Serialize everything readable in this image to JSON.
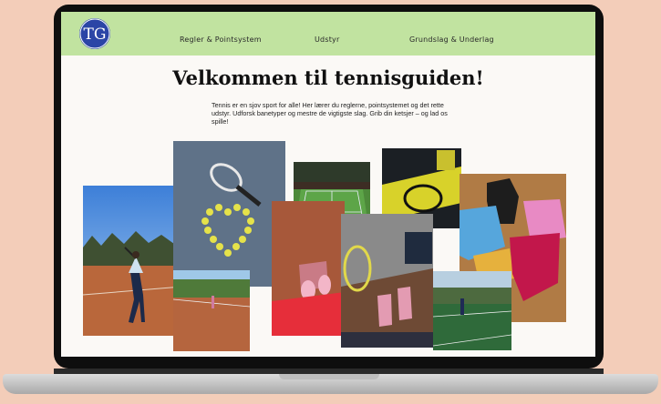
{
  "nav": {
    "logo_text": "TG",
    "links": [
      "Regler & Pointsystem",
      "Udstyr",
      "Grundslag & Underlag"
    ]
  },
  "hero": {
    "title": "Velkommen til tennisguiden!",
    "intro": "Tennis er en sjov sport for alle! Her lærer du reglerne, pointsystemet og det rette udstyr. Udforsk banetyper og mestre de vigtigste slag. Grib din ketsjer – og lad os spille!"
  },
  "colors": {
    "nav_bg": "#c1e3a0",
    "logo_bg": "#2b45a6",
    "page_bg": "#fbf9f6",
    "backdrop": "#f3cdb9"
  },
  "gallery": {
    "photos": [
      {
        "name": "player-serving-photo"
      },
      {
        "name": "racket-ball-heart-photo"
      },
      {
        "name": "grass-court-photo"
      },
      {
        "name": "bag-racket-photo"
      },
      {
        "name": "clothes-flatlay-photo"
      },
      {
        "name": "clay-court-photo"
      },
      {
        "name": "red-skirt-shoes-photo"
      },
      {
        "name": "feet-racket-photo"
      },
      {
        "name": "hard-court-photo"
      }
    ]
  }
}
